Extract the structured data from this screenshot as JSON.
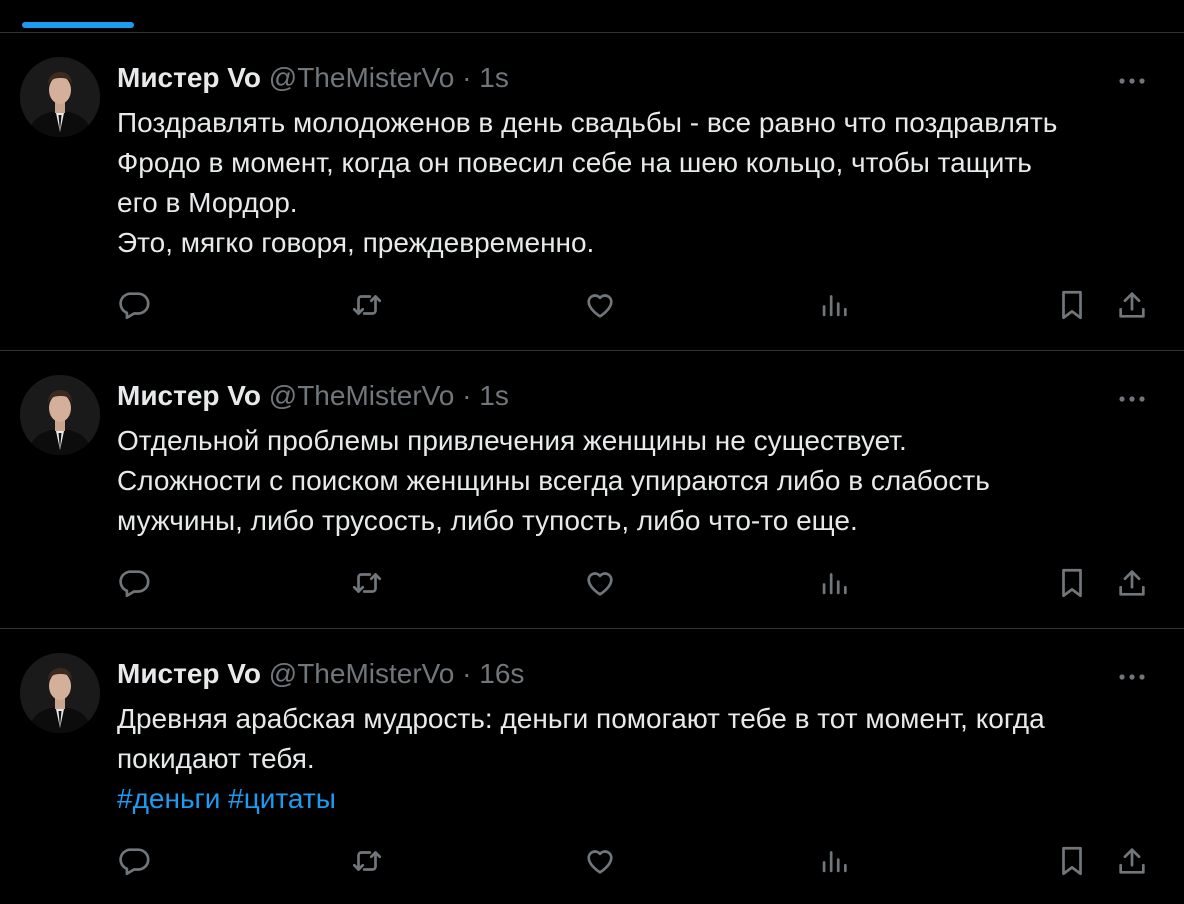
{
  "tweets": [
    {
      "author": {
        "name": "Мистер Vo",
        "handle": "@TheMisterVo",
        "time": "1s"
      },
      "lines": [
        "Поздравлять молодоженов в день свадьбы - все равно что поздравлять",
        "Фродо в момент, когда он повесил себе на шею кольцо, чтобы тащить",
        "его в Мордор.",
        "Это, мягко говоря, преждевременно."
      ],
      "hashtags": []
    },
    {
      "author": {
        "name": "Мистер Vo",
        "handle": "@TheMisterVo",
        "time": "1s"
      },
      "lines": [
        "Отдельной проблемы привлечения женщины не существует.",
        "Сложности с поиском женщины всегда упираются либо в слабость",
        "мужчины, либо трусость, либо тупость, либо что-то еще."
      ],
      "hashtags": []
    },
    {
      "author": {
        "name": "Мистер Vo",
        "handle": "@TheMisterVo",
        "time": "16s"
      },
      "lines": [
        "Древняя арабская мудрость: деньги помогают тебе в тот момент, когда",
        "покидают тебя."
      ],
      "hashtags": [
        "#деньги",
        "#цитаты"
      ]
    }
  ],
  "separator": "·",
  "icons": {
    "more": "more-horizontal-icon",
    "reply": "reply-icon",
    "retweet": "retweet-icon",
    "like": "like-heart-icon",
    "views": "views-bar-chart-icon",
    "bookmark": "bookmark-icon",
    "share": "share-upload-icon"
  },
  "colors": {
    "background": "#000000",
    "text": "#e7e9ea",
    "secondary": "#71767b",
    "accent": "#1d9bf0",
    "divider": "#2f3336"
  }
}
